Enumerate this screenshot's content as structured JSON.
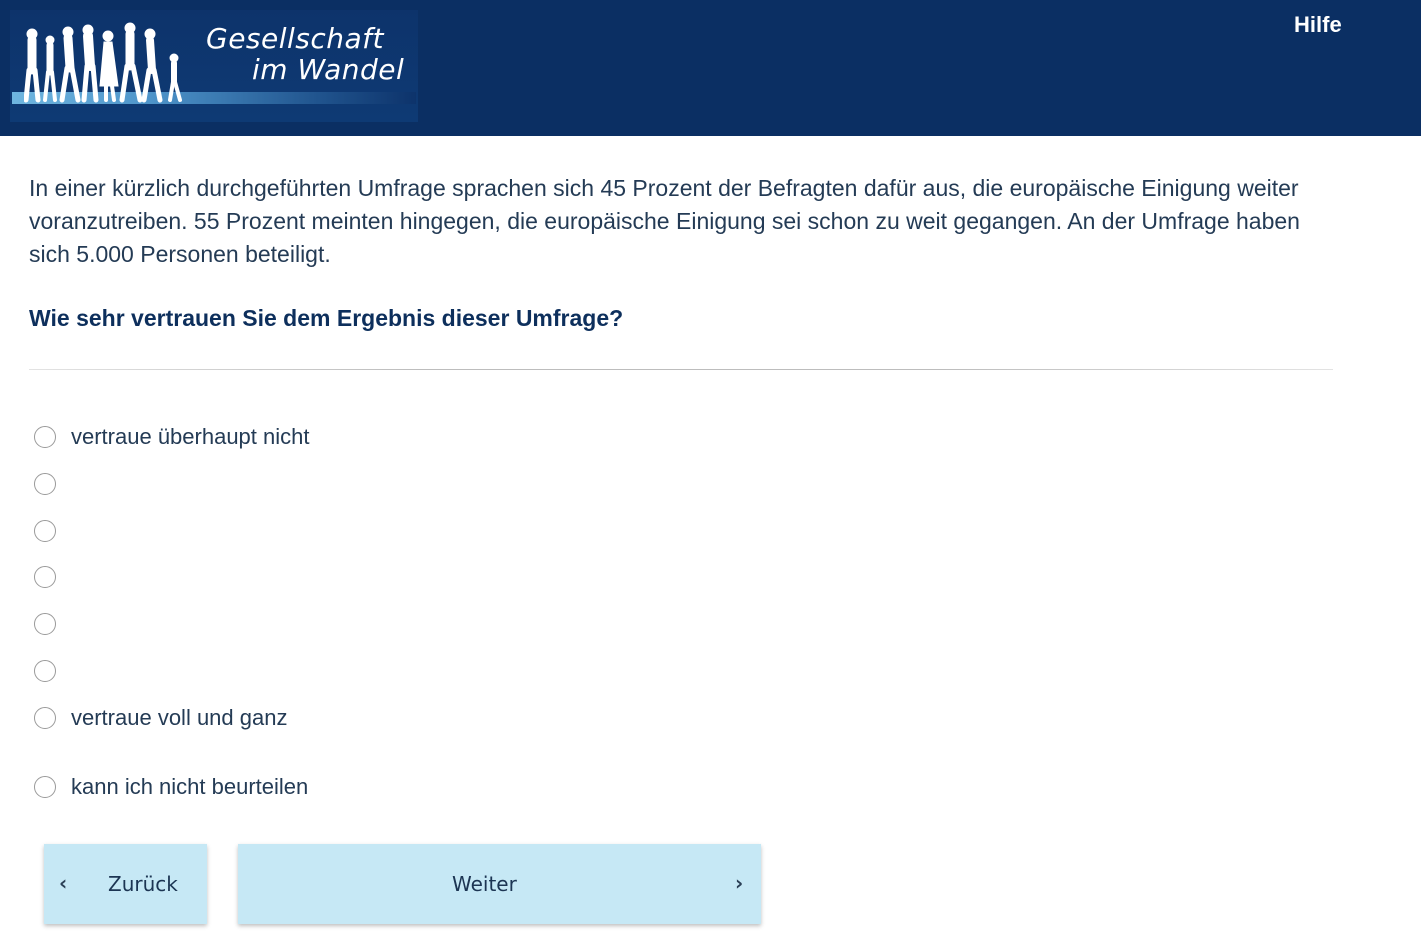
{
  "header": {
    "logo": {
      "line1": "Gesellschaft",
      "line2": "im Wandel"
    },
    "help_link": "Hilfe"
  },
  "question": {
    "intro": "In einer kürzlich durchgeführten Umfrage sprachen sich 45 Prozent der Befragten dafür aus, die europäische Einigung weiter voranzutreiben. 55 Prozent meinten hingegen, die europäische Einigung sei schon zu weit gegangen. An der Umfrage haben sich 5.000 Personen beteiligt.",
    "text": "Wie sehr vertrauen Sie dem Ergebnis dieser Umfrage?",
    "options": [
      {
        "label": "vertraue überhaupt nicht",
        "selected": false
      },
      {
        "label": "",
        "selected": false
      },
      {
        "label": "",
        "selected": false
      },
      {
        "label": "",
        "selected": false
      },
      {
        "label": "",
        "selected": false
      },
      {
        "label": "",
        "selected": false
      },
      {
        "label": "vertraue voll und ganz",
        "selected": false
      },
      {
        "label": "kann ich nicht beurteilen",
        "selected": false
      }
    ]
  },
  "nav": {
    "back_label": "Zurück",
    "next_label": "Weiter",
    "back_icon": "chevron-left-icon",
    "next_icon": "chevron-right-icon"
  },
  "colors": {
    "header_bg": "#0b2f63",
    "button_bg": "#c6e8f5",
    "question_text": "#0d2f5c"
  }
}
